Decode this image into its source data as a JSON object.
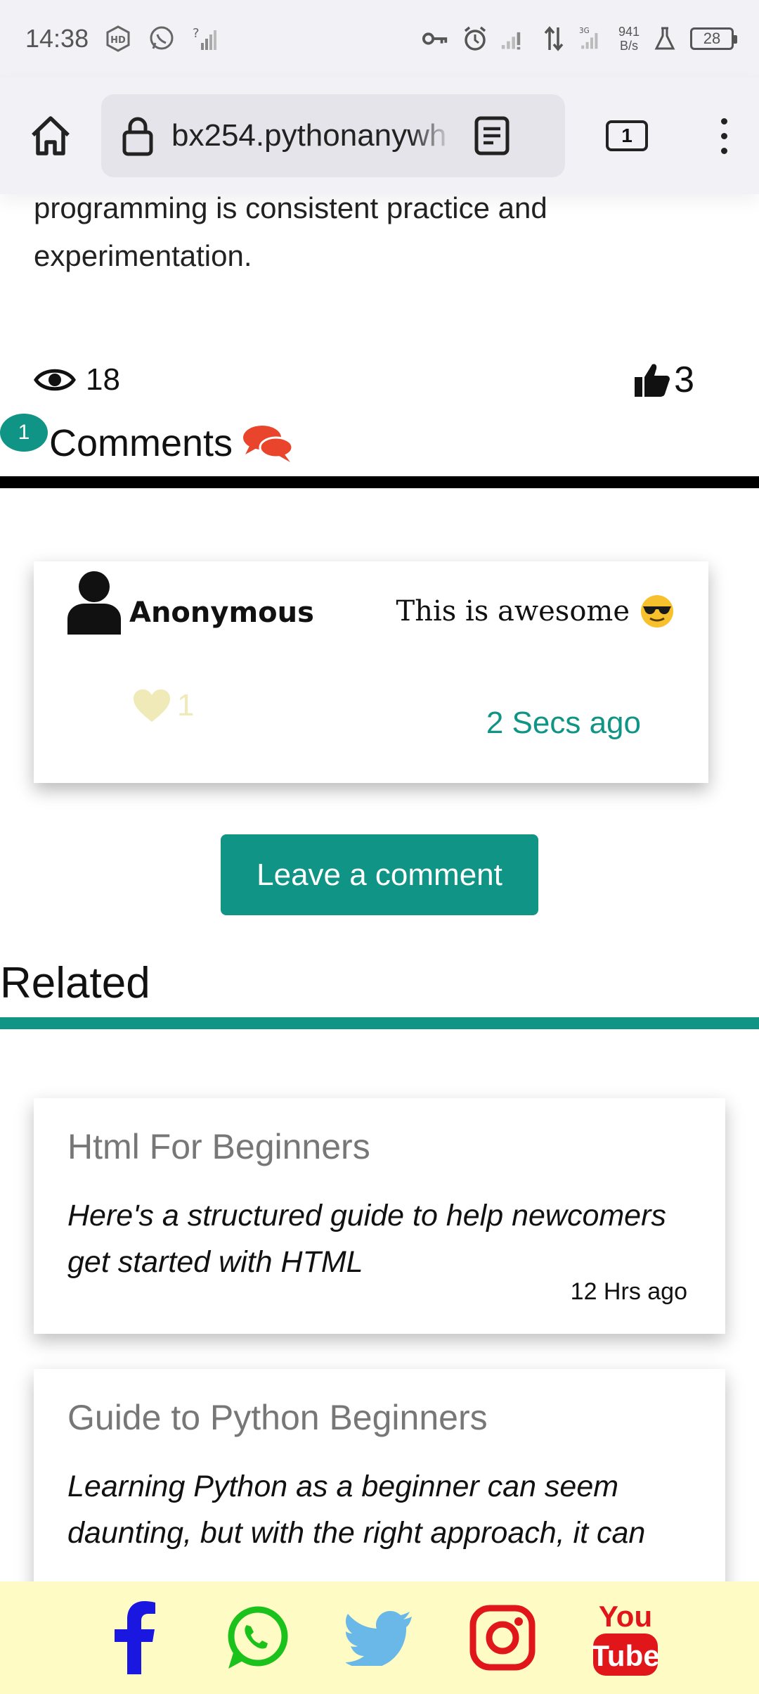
{
  "status_bar": {
    "time": "14:38",
    "net_speed_value": "941",
    "net_speed_unit": "B/s",
    "network_type": "3G",
    "battery": "28"
  },
  "browser": {
    "url": "bx254.pythonanywh",
    "tab_count": "1"
  },
  "article": {
    "tail_text": "programming is consistent practice and experimentation.",
    "views": "18",
    "likes": "3"
  },
  "comments": {
    "count": "1",
    "title": "Comments",
    "items": [
      {
        "author": "Anonymous",
        "text": "This is awesome",
        "likes": "1",
        "time": "2 Secs ago"
      }
    ],
    "leave_label": "Leave a comment"
  },
  "related": {
    "title": "Related",
    "items": [
      {
        "title": "Html For Beginners",
        "excerpt": "Here's a structured guide to help newcomers get started with HTML",
        "time": "12 Hrs ago"
      },
      {
        "title": "Guide to Python Beginners",
        "excerpt": "Learning Python as a beginner can seem daunting, but with the right approach, it can"
      }
    ]
  },
  "social": {
    "icons": [
      "facebook-icon",
      "whatsapp-icon",
      "twitter-icon",
      "instagram-icon",
      "youtube-icon"
    ],
    "youtube_top": "You",
    "youtube_bottom": "Tube"
  },
  "colors": {
    "accent": "#0f9485",
    "chat_icon": "#e8452c",
    "footer_bg": "#fefcc4",
    "facebook": "#1a18e0",
    "whatsapp": "#1bc21b",
    "twitter": "#6ab8e8",
    "instagram": "#e0161a",
    "youtube": "#e0161a"
  }
}
